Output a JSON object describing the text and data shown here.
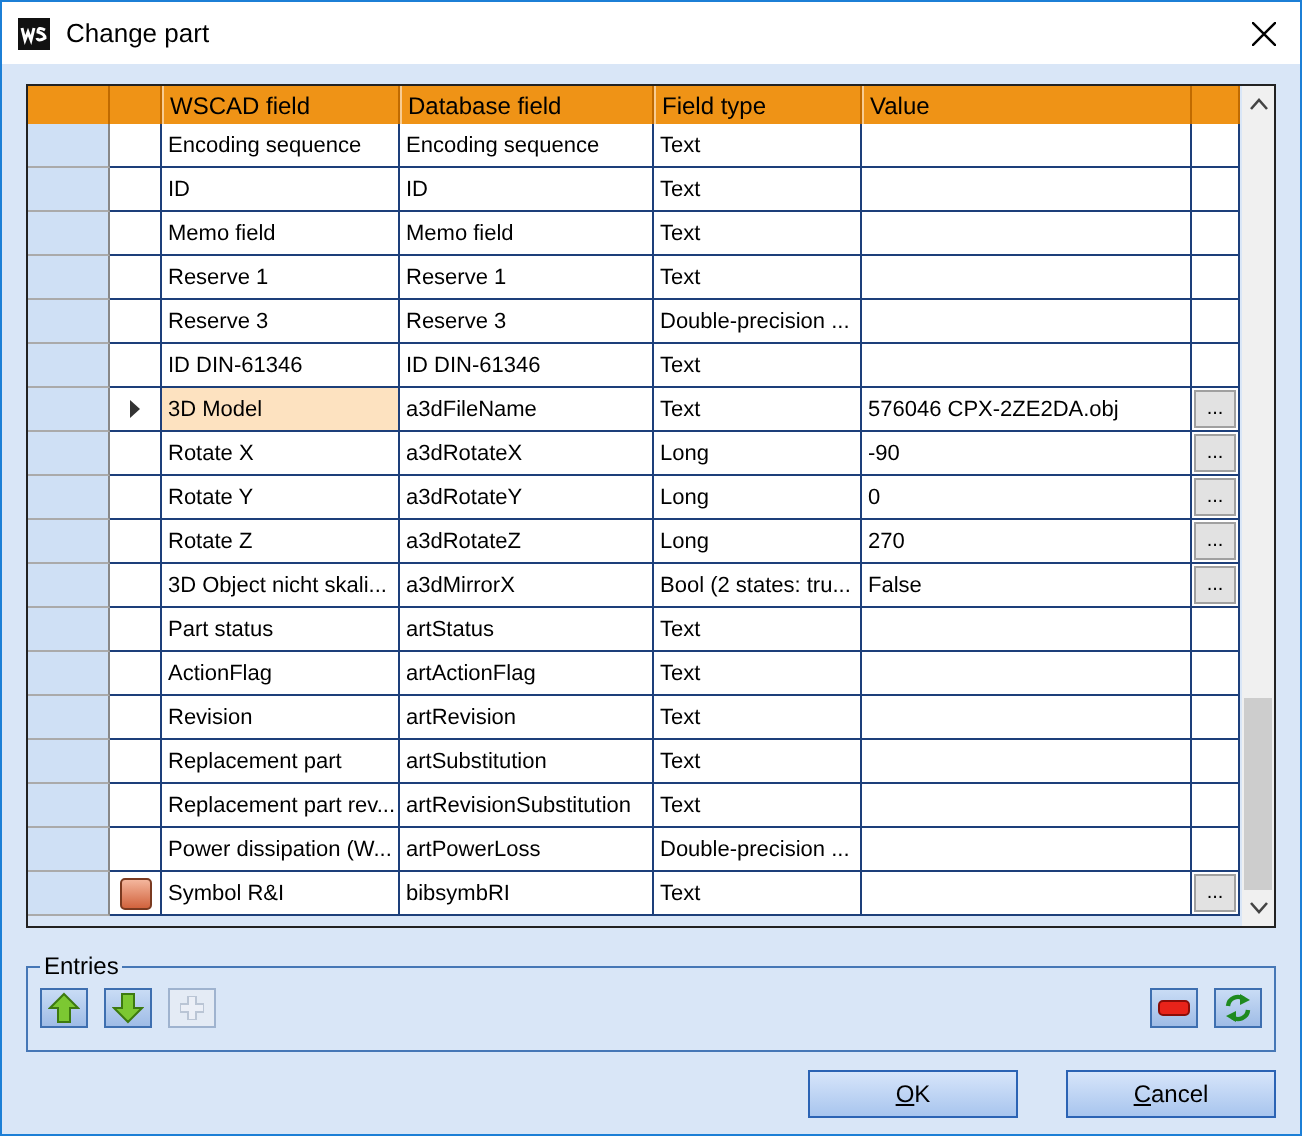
{
  "window": {
    "title": "Change part"
  },
  "table": {
    "columns": [
      "WSCAD field",
      "Database field",
      "Field type",
      "Value"
    ],
    "rows": [
      {
        "wscad": "Encoding sequence",
        "database": "Encoding sequence",
        "type": "Text",
        "value": "",
        "selected": false,
        "has_button": false,
        "has_symbol": false
      },
      {
        "wscad": "ID",
        "database": "ID",
        "type": "Text",
        "value": "",
        "selected": false,
        "has_button": false,
        "has_symbol": false
      },
      {
        "wscad": "Memo field",
        "database": "Memo field",
        "type": "Text",
        "value": "",
        "selected": false,
        "has_button": false,
        "has_symbol": false
      },
      {
        "wscad": "Reserve 1",
        "database": "Reserve 1",
        "type": "Text",
        "value": "",
        "selected": false,
        "has_button": false,
        "has_symbol": false
      },
      {
        "wscad": "Reserve 3",
        "database": "Reserve 3",
        "type": "Double-precision ...",
        "value": "",
        "selected": false,
        "has_button": false,
        "has_symbol": false
      },
      {
        "wscad": "ID DIN-61346",
        "database": "ID DIN-61346",
        "type": "Text",
        "value": "",
        "selected": false,
        "has_button": false,
        "has_symbol": false
      },
      {
        "wscad": "3D Model",
        "database": "a3dFileName",
        "type": "Text",
        "value": "576046 CPX-2ZE2DA.obj",
        "selected": true,
        "has_button": true,
        "button_label": "...",
        "has_symbol": false
      },
      {
        "wscad": "Rotate X",
        "database": "a3dRotateX",
        "type": "Long",
        "value": "-90",
        "selected": false,
        "has_button": true,
        "button_label": "...",
        "has_symbol": false
      },
      {
        "wscad": "Rotate Y",
        "database": "a3dRotateY",
        "type": "Long",
        "value": "0",
        "selected": false,
        "has_button": true,
        "button_label": "...",
        "has_symbol": false
      },
      {
        "wscad": "Rotate Z",
        "database": "a3dRotateZ",
        "type": "Long",
        "value": "270",
        "selected": false,
        "has_button": true,
        "button_label": "...",
        "has_symbol": false
      },
      {
        "wscad": "3D Object nicht skali...",
        "database": "a3dMirrorX",
        "type": "Bool (2 states: tru...",
        "value": "False",
        "selected": false,
        "has_button": true,
        "button_label": "...",
        "has_symbol": false
      },
      {
        "wscad": "Part status",
        "database": "artStatus",
        "type": "Text",
        "value": "",
        "selected": false,
        "has_button": false,
        "has_symbol": false
      },
      {
        "wscad": "ActionFlag",
        "database": "artActionFlag",
        "type": "Text",
        "value": "",
        "selected": false,
        "has_button": false,
        "has_symbol": false
      },
      {
        "wscad": "Revision",
        "database": "artRevision",
        "type": "Text",
        "value": "",
        "selected": false,
        "has_button": false,
        "has_symbol": false
      },
      {
        "wscad": "Replacement part",
        "database": "artSubstitution",
        "type": "Text",
        "value": "",
        "selected": false,
        "has_button": false,
        "has_symbol": false
      },
      {
        "wscad": "Replacement part rev...",
        "database": "artRevisionSubstitution",
        "type": "Text",
        "value": "",
        "selected": false,
        "has_button": false,
        "has_symbol": false
      },
      {
        "wscad": "Power dissipation (W...",
        "database": "artPowerLoss",
        "type": "Double-precision ...",
        "value": "",
        "selected": false,
        "has_button": false,
        "has_symbol": false
      },
      {
        "wscad": "Symbol R&I",
        "database": "bibsymbRI",
        "type": "Text",
        "value": "",
        "selected": false,
        "has_button": true,
        "button_label": "...",
        "has_symbol": true
      }
    ]
  },
  "entries": {
    "title": "Entries",
    "tools": [
      {
        "kind": "up",
        "disabled": false
      },
      {
        "kind": "down",
        "disabled": false
      },
      {
        "kind": "add",
        "disabled": true
      }
    ],
    "right_tools": [
      {
        "kind": "remove",
        "disabled": false
      },
      {
        "kind": "refresh",
        "disabled": false
      }
    ]
  },
  "buttons": [
    {
      "accel": "O",
      "rest": "K"
    },
    {
      "accel": "C",
      "rest": "ancel"
    }
  ]
}
